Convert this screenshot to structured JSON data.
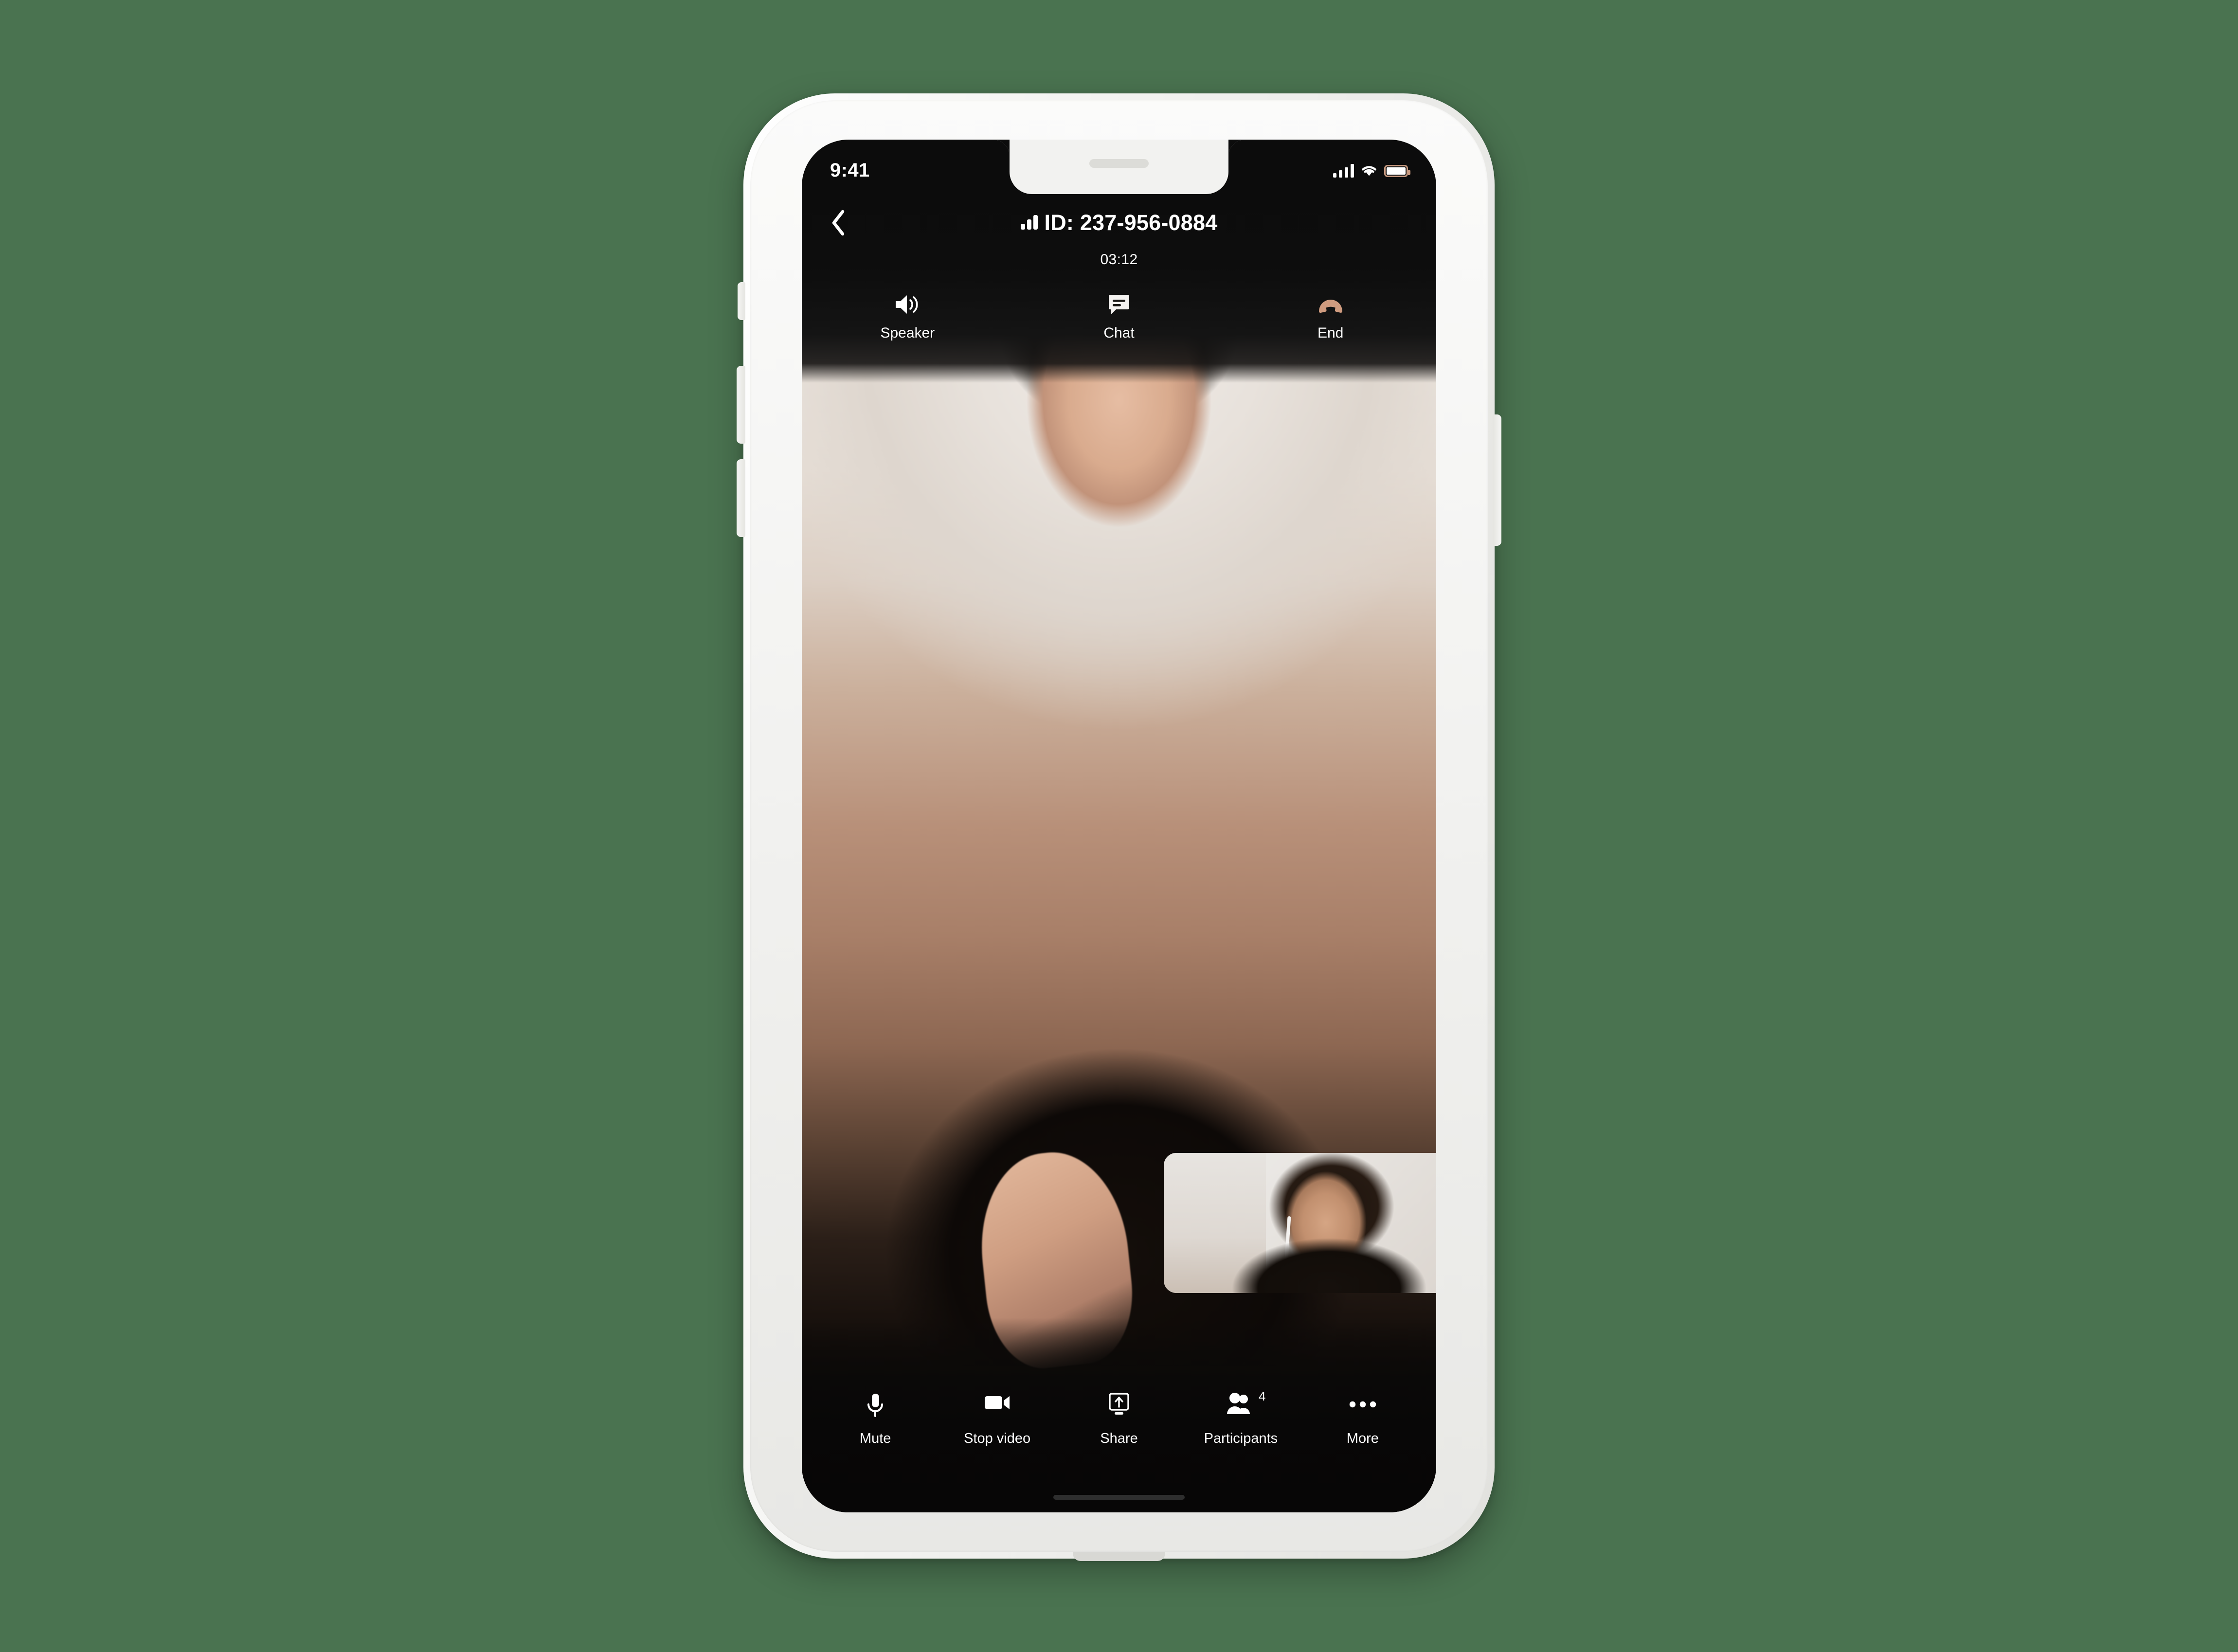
{
  "background": {
    "color": "#4a7350"
  },
  "device": {
    "name": "smartphone-mockup",
    "frame_color": "#f2f2f0",
    "buttons": {
      "silent_switch": "silent-switch",
      "volume_up": "volume-up-button",
      "volume_down": "volume-down-button",
      "power": "power-button"
    }
  },
  "status_bar": {
    "time": "9:41",
    "cellular_icon": "cellular-signal-icon",
    "wifi_icon": "wifi-icon",
    "battery_icon": "battery-icon",
    "battery_accent": "#c89a80"
  },
  "call_header": {
    "back_icon": "back-chevron-icon",
    "signal_icon": "connection-quality-icon",
    "meeting_id": "ID: 237-956-0884",
    "duration": "03:12"
  },
  "top_toolbar": {
    "items": [
      {
        "label": "Speaker",
        "icon": "speaker-icon",
        "color": "#ffffff"
      },
      {
        "label": "Chat",
        "icon": "chat-bubble-icon",
        "color": "#ffffff"
      },
      {
        "label": "End",
        "icon": "end-call-icon",
        "color": "#cf9b7f"
      }
    ]
  },
  "bottom_toolbar": {
    "items": [
      {
        "label": "Mute",
        "icon": "microphone-icon",
        "badge": ""
      },
      {
        "label": "Stop video",
        "icon": "video-camera-icon",
        "badge": ""
      },
      {
        "label": "Share",
        "icon": "screen-share-icon",
        "badge": ""
      },
      {
        "label": "Participants",
        "icon": "participants-icon",
        "badge": "4"
      },
      {
        "label": "More",
        "icon": "more-ellipsis-icon",
        "badge": ""
      }
    ]
  },
  "video": {
    "remote_participant": "remote-video-feed",
    "self_view": "self-view-thumbnail",
    "tone": "sepia-duotone"
  }
}
